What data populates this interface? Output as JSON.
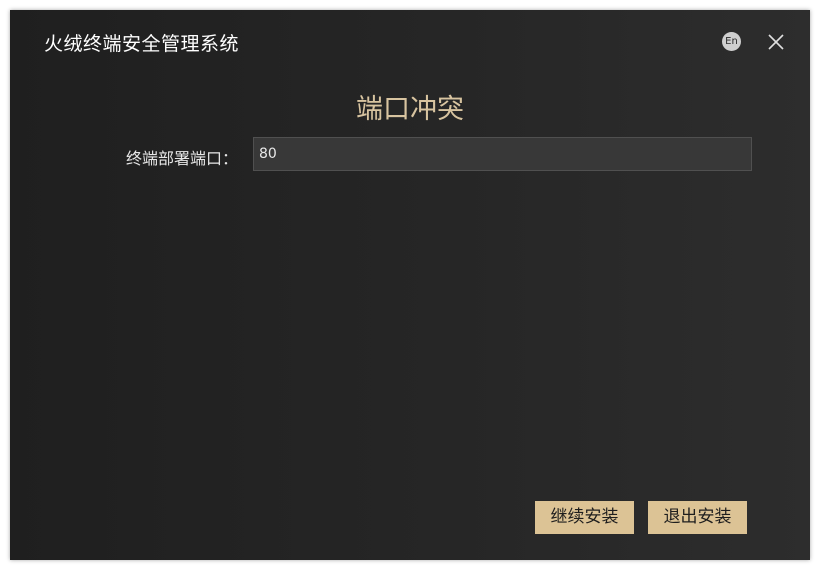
{
  "window": {
    "title": "火绒终端安全管理系统",
    "language_label": "En",
    "close_icon": "close-icon"
  },
  "dialog": {
    "heading": "端口冲突",
    "port_field": {
      "label": "终端部署端口：",
      "value": "80"
    }
  },
  "actions": {
    "continue_label": "继续安装",
    "exit_label": "退出安装"
  },
  "colors": {
    "background": "#262626",
    "accent": "#dcc395",
    "heading": "#d8c4a0",
    "input_background": "#383838"
  }
}
